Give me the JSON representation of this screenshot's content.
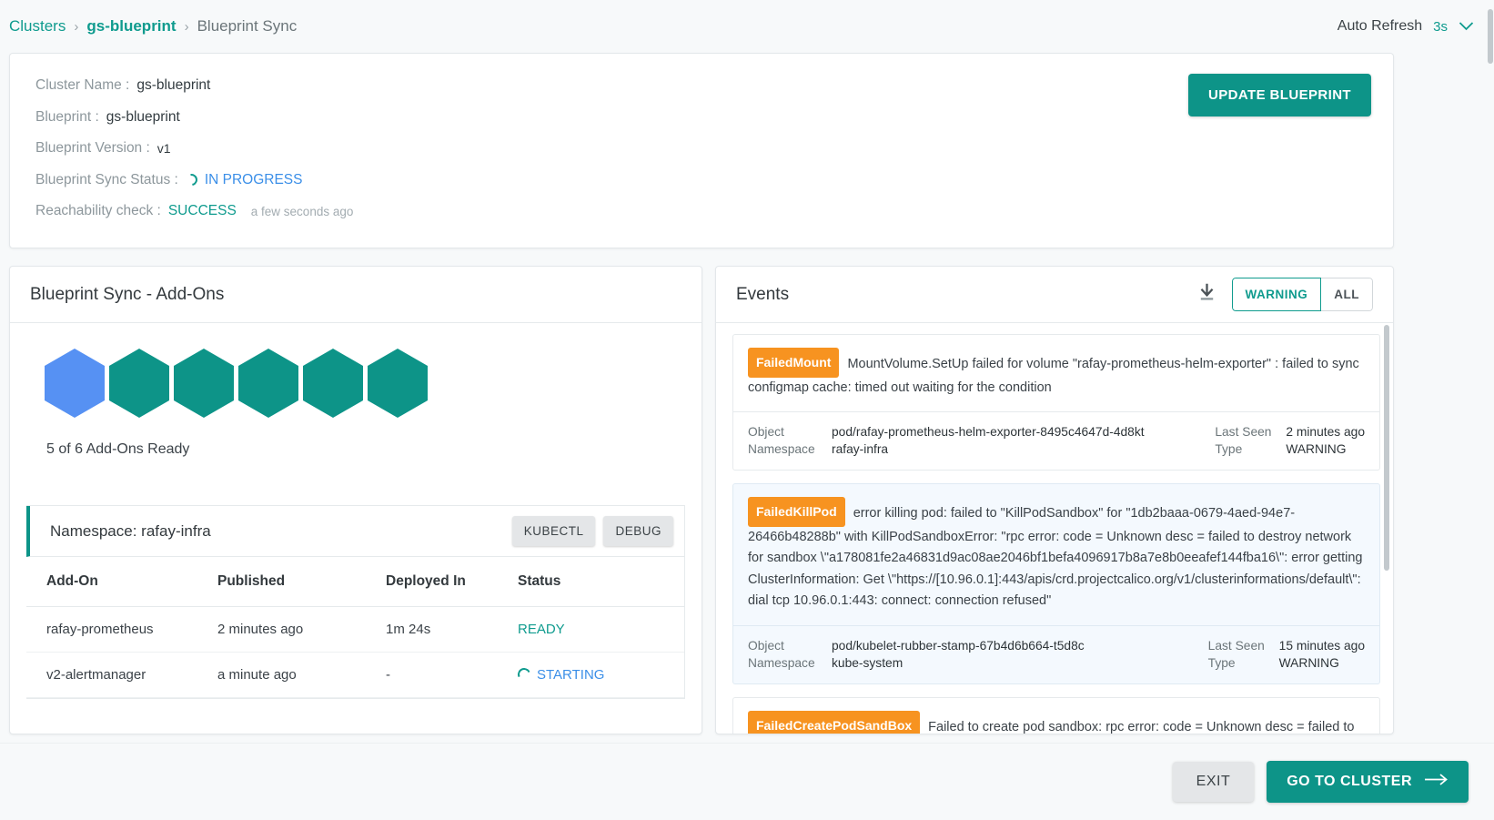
{
  "breadcrumb": {
    "items": [
      {
        "label": "Clusters",
        "type": "link"
      },
      {
        "label": "gs-blueprint",
        "type": "link"
      },
      {
        "label": "Blueprint Sync",
        "type": "current"
      }
    ],
    "separator": "›"
  },
  "auto_refresh": {
    "label": "Auto Refresh",
    "value": "3s",
    "chevron": "chevron-down-icon"
  },
  "summary": {
    "fields": [
      {
        "key": "Cluster Name :",
        "value": "gs-blueprint"
      },
      {
        "key": "Blueprint :",
        "value": "gs-blueprint"
      },
      {
        "key": "Blueprint Version :",
        "value": "v1"
      }
    ],
    "sync_status_label": "Blueprint Sync Status :",
    "sync_status_value": "IN PROGRESS",
    "reachability_label": "Reachability check :",
    "reachability_value": "SUCCESS",
    "reachability_time": "a few seconds ago",
    "update_button": "UPDATE BLUEPRINT"
  },
  "addons_panel": {
    "title": "Blueprint Sync - Add-Ons",
    "hexagons": [
      {
        "state": "pending",
        "color": "#5691f3"
      },
      {
        "state": "ready",
        "color": "#0d9488"
      },
      {
        "state": "ready",
        "color": "#0d9488"
      },
      {
        "state": "ready",
        "color": "#0d9488"
      },
      {
        "state": "ready",
        "color": "#0d9488"
      },
      {
        "state": "ready",
        "color": "#0d9488"
      }
    ],
    "ready_text": "5 of 6 Add-Ons Ready",
    "namespace_title": "Namespace: rafay-infra",
    "kubectl_button": "KUBECTL",
    "debug_button": "DEBUG",
    "columns": [
      "Add-On",
      "Published",
      "Deployed In",
      "Status"
    ],
    "rows": [
      {
        "addon": "rafay-prometheus",
        "published": "2 minutes ago",
        "deployed_in": "1m 24s",
        "status": "READY",
        "status_kind": "ready"
      },
      {
        "addon": "v2-alertmanager",
        "published": "a minute ago",
        "deployed_in": "-",
        "status": "STARTING",
        "status_kind": "starting"
      }
    ]
  },
  "events_panel": {
    "title": "Events",
    "download_icon": "download-icon",
    "filters": [
      {
        "label": "WARNING",
        "selected": true
      },
      {
        "label": "ALL",
        "selected": false
      }
    ],
    "meta_labels": {
      "object": "Object",
      "namespace": "Namespace",
      "last_seen": "Last Seen",
      "type": "Type"
    },
    "events": [
      {
        "tag": "FailedMount",
        "message": "MountVolume.SetUp failed for volume \"rafay-prometheus-helm-exporter\" : failed to sync configmap cache: timed out waiting for the condition",
        "object": "pod/rafay-prometheus-helm-exporter-8495c4647d-4d8kt",
        "namespace": "rafay-infra",
        "last_seen": "2 minutes ago",
        "type": "WARNING",
        "highlighted": false
      },
      {
        "tag": "FailedKillPod",
        "message": "error killing pod: failed to \"KillPodSandbox\" for \"1db2baaa-0679-4aed-94e7-26466b48288b\" with KillPodSandboxError: \"rpc error: code = Unknown desc = failed to destroy network for sandbox \\\"a178081fe2a46831d9ac08ae2046bf1befa4096917b8a7e8b0eeafef144fba16\\\": error getting ClusterInformation: Get \\\"https://[10.96.0.1]:443/apis/crd.projectcalico.org/v1/clusterinformations/default\\\": dial tcp 10.96.0.1:443: connect: connection refused\"",
        "object": "pod/kubelet-rubber-stamp-67b4d6b664-t5d8c",
        "namespace": "kube-system",
        "last_seen": "15 minutes ago",
        "type": "WARNING",
        "highlighted": true
      },
      {
        "tag": "FailedCreatePodSandBox",
        "message": "Failed to create pod sandbox: rpc error: code = Unknown desc = failed to setup",
        "object": "",
        "namespace": "",
        "last_seen": "",
        "type": "",
        "highlighted": false
      }
    ]
  },
  "footer": {
    "exit_button": "EXIT",
    "go_button": "GO TO CLUSTER",
    "go_arrow": "arrow-right-icon"
  },
  "colors": {
    "accent_teal": "#0d9488",
    "link_teal": "#0f9b8e",
    "info_blue": "#3b8fe8",
    "hex_pending": "#5691f3",
    "tag_orange": "#f79320",
    "page_bg": "#f7f9fa"
  }
}
